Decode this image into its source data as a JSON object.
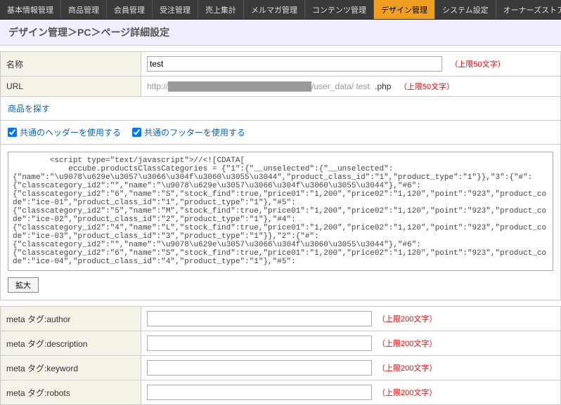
{
  "nav": {
    "tabs": [
      "基本情報管理",
      "商品管理",
      "会員管理",
      "受注管理",
      "売上集計",
      "メルマガ管理",
      "コンテンツ管理",
      "デザイン管理",
      "システム設定",
      "オーナーズストア"
    ],
    "active": 7
  },
  "breadcrumb": "デザイン管理＞PC＞ページ詳細設定",
  "fields": {
    "name_label": "名称",
    "name_value": "test",
    "name_limit": "（上限50文字）",
    "url_label": "URL",
    "url_prefix": "http://████████████████████████/user_data/ test",
    "url_ext": ".php",
    "url_limit": "（上限50文字）"
  },
  "link_back": "商品を探す",
  "checkboxes": {
    "header": "共通のヘッダーを使用する",
    "footer": "共通のフッターを使用する"
  },
  "code": "        <script type=\"text/javascript\">//<![CDATA[\n            eccube.productsClassCategories = {\"1\":{\"__unselected\":{\"__unselected\":{\"name\":\"\\u9078\\u629e\\u3057\\u3066\\u304f\\u3060\\u3055\\u3044\",\"product_class_id\":\"1\",\"product_type\":\"1\"}},\"3\":{\"#\":{\"classcategory_id2\":\"\",\"name\":\"\\u9078\\u629e\\u3057\\u3066\\u304f\\u3060\\u3055\\u3044\"},\"#6\":{\"classcategory_id2\":\"6\",\"name\":\"S\",\"stock_find\":true,\"price01\":\"1,200\",\"price02\":\"1,120\",\"point\":\"923\",\"product_code\":\"ice-01\",\"product_class_id\":\"1\",\"product_type\":\"1\"},\"#5\":{\"classcategory_id2\":\"5\",\"name\":\"M\",\"stock_find\":true,\"price01\":\"1,200\",\"price02\":\"1,120\",\"point\":\"923\",\"product_code\":\"ice-02\",\"product_class_id\":\"2\",\"product_type\":\"1\"},\"#4\":{\"classcategory_id2\":\"4\",\"name\":\"L\",\"stock_find\":true,\"price01\":\"1,200\",\"price02\":\"1,120\",\"point\":\"923\",\"product_code\":\"ice-03\",\"product_class_id\":\"3\",\"product_type\":\"1\"}},\"2\":{\"#\":{\"classcategory_id2\":\"\",\"name\":\"\\u9078\\u629e\\u3057\\u3066\\u304f\\u3060\\u3055\\u3044\"},\"#6\":{\"classcategory_id2\":\"6\",\"name\":\"S\",\"stock_find\":true,\"price01\":\"1,200\",\"price02\":\"1,120\",\"point\":\"923\",\"product_code\":\"ice-04\",\"product_class_id\":\"4\",\"product_type\":\"1\"},\"#5\":",
  "expand_label": "拡大",
  "meta": [
    {
      "label": "meta タグ:author",
      "limit": "（上限200文字）"
    },
    {
      "label": "meta タグ:description",
      "limit": "（上限200文字）"
    },
    {
      "label": "meta タグ:keyword",
      "limit": "（上限200文字）"
    },
    {
      "label": "meta タグ:robots",
      "limit": "（上限200文字）"
    }
  ]
}
